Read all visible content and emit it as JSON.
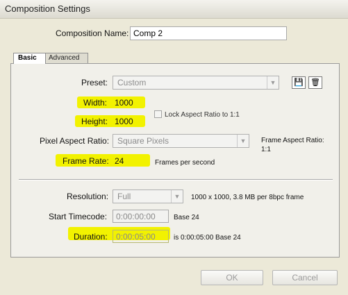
{
  "window": {
    "title": "Composition Settings"
  },
  "composition": {
    "name_label": "Composition Name:",
    "name_value": "Comp 2"
  },
  "tabs": {
    "basic": "Basic",
    "advanced": "Advanced"
  },
  "preset": {
    "label": "Preset:",
    "value": "Custom"
  },
  "width": {
    "label": "Width:",
    "value": "1000"
  },
  "height": {
    "label": "Height:",
    "value": "1000"
  },
  "lock_aspect": {
    "label": "Lock Aspect Ratio to 1:1",
    "checked": false
  },
  "pixel_aspect": {
    "label": "Pixel Aspect Ratio:",
    "value": "Square Pixels"
  },
  "frame_aspect": {
    "label": "Frame Aspect Ratio:",
    "value": "1:1"
  },
  "frame_rate": {
    "label": "Frame Rate:",
    "value": "24",
    "unit": "Frames per second"
  },
  "resolution": {
    "label": "Resolution:",
    "value": "Full",
    "info": "1000 x 1000, 3.8 MB per 8bpc frame"
  },
  "start_timecode": {
    "label": "Start Timecode:",
    "value": "0:00:00:00",
    "base": "Base 24"
  },
  "duration": {
    "label": "Duration:",
    "value": "0:00:05:00",
    "info": "is 0:00:05:00  Base 24"
  },
  "buttons": {
    "ok": "OK",
    "cancel": "Cancel"
  },
  "colors": {
    "highlight": "#f2f200",
    "dialog_bg": "#ece9d8"
  }
}
